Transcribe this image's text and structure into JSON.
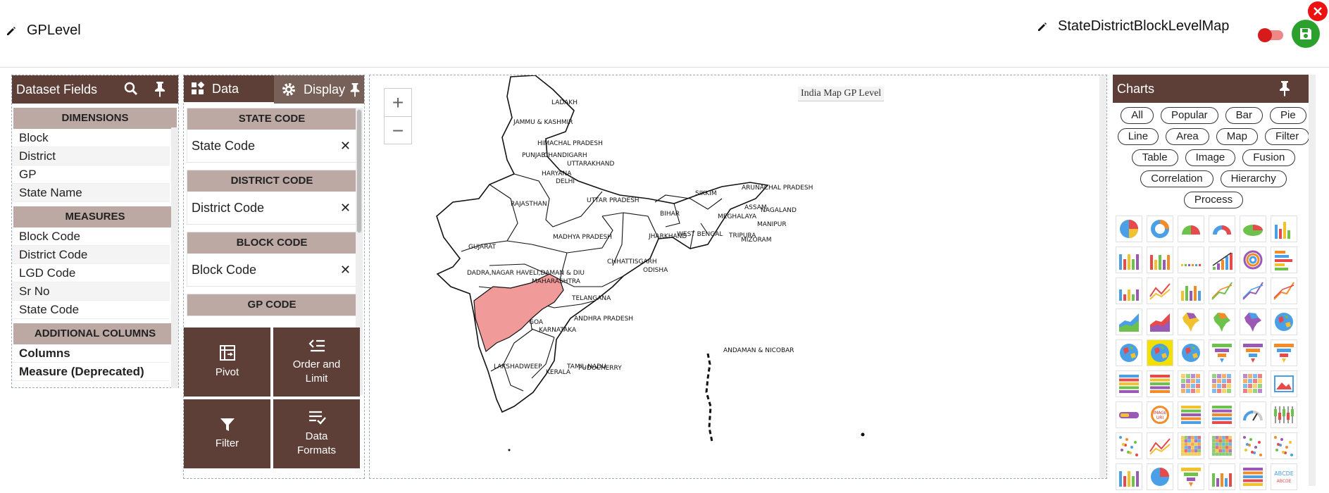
{
  "header": {
    "left_title": "GPLevel",
    "right_title": "StateDistrictBlockLevelMap"
  },
  "dataset": {
    "title": "Dataset Fields",
    "dimensions_label": "DIMENSIONS",
    "dimensions": [
      "Block",
      "District",
      "GP",
      "State Name"
    ],
    "measures_label": "MEASURES",
    "measures": [
      "Block Code",
      "District Code",
      "LGD Code",
      "Sr No",
      "State Code"
    ],
    "additional_label": "ADDITIONAL COLUMNS",
    "additional": [
      "Columns",
      "Measure (Deprecated)"
    ]
  },
  "config": {
    "tab_data": "Data",
    "tab_display": "Display",
    "fields": [
      {
        "head": "STATE CODE",
        "value": "State Code"
      },
      {
        "head": "DISTRICT CODE",
        "value": "District Code"
      },
      {
        "head": "BLOCK CODE",
        "value": "Block Code"
      },
      {
        "head": "GP CODE",
        "value": ""
      }
    ],
    "remove_symbol": "✕",
    "actions": {
      "pivot": "Pivot",
      "order": "Order and Limit",
      "filter": "Filter",
      "formats": "Data Formats"
    }
  },
  "map": {
    "title": "India Map GP Level",
    "zoom_in": "+",
    "zoom_out": "−",
    "highlight_color": "#f09a9a",
    "labels": {
      "ladakh": "LADAKH",
      "jk": "JAMMU & KASHMIR",
      "hp": "HIMACHAL PRADESH",
      "punjab": "PUNJAB",
      "chandigarh": "CHANDIGARH",
      "uttarakhand": "UTTARAKHAND",
      "haryana": "HARYANA",
      "delhi": "DELHI",
      "rajasthan": "RAJASTHAN",
      "up": "UTTAR PRADESH",
      "sikkim": "SIKKIM",
      "arunachal": "ARUNACHAL PRADESH",
      "assam": "ASSAM",
      "nagaland": "NAGALAND",
      "meghalaya": "MEGHALAYA",
      "manipur": "MANIPUR",
      "bihar": "BIHAR",
      "tripura": "TRIPURA",
      "mizoram": "MIZORAM",
      "jharkhand": "JHARKHAND",
      "wb": "WEST BENGAL",
      "mp": "MADHYA PRADESH",
      "gujarat": "GUJARAT",
      "chhattisgarh": "CHHATTISGARH",
      "odisha": "ODISHA",
      "dnh": "DADRA,NAGAR HAVELI,DAMAN & DIU",
      "maharashtra": "MAHARASHTRA",
      "telangana": "TELANGANA",
      "goa": "GOA",
      "ap": "ANDHRA PRADESH",
      "karnataka": "KARNATAKA",
      "andaman": "ANDAMAN & NICOBAR",
      "lakshadweep": "LAKSHADWEEP",
      "kerala": "KERALA",
      "tn": "TAMIL NADU",
      "puducherry": "PUDUCHERRY"
    }
  },
  "charts": {
    "title": "Charts",
    "filters": [
      "All",
      "Popular",
      "Bar",
      "Pie",
      "Line",
      "Area",
      "Map",
      "Filter",
      "Table",
      "Image",
      "Fusion",
      "Correlation",
      "Hierarchy",
      "Process"
    ],
    "image_uri_label": "IMAGE URI",
    "abcde_label": "ABCDE"
  }
}
